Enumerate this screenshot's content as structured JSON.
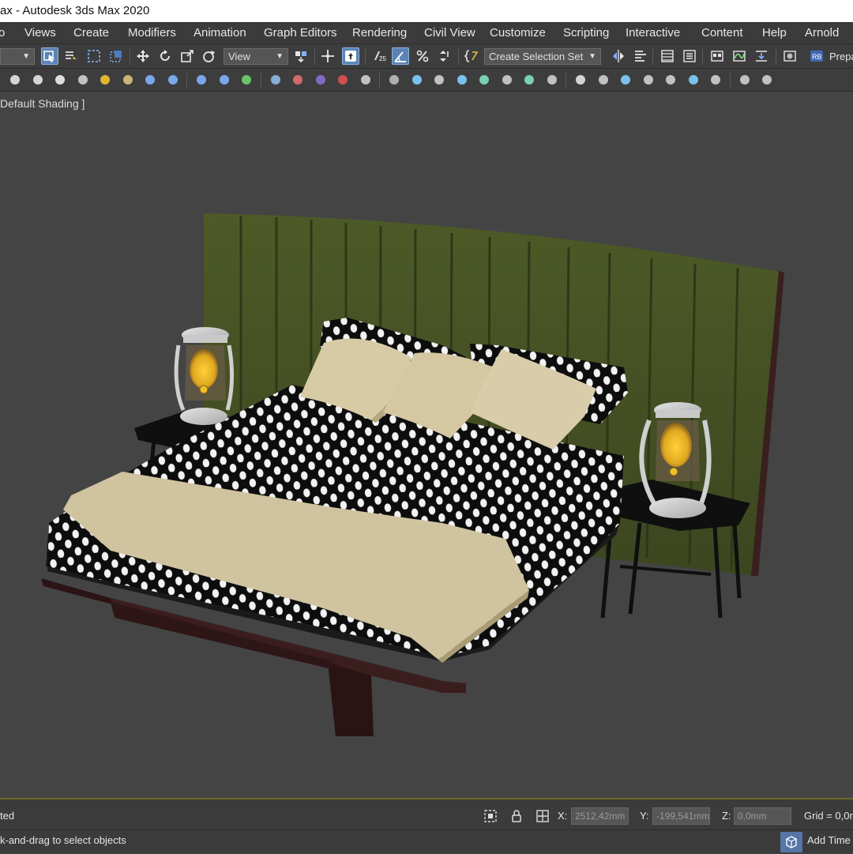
{
  "window": {
    "title": "ax - Autodesk 3ds Max 2020"
  },
  "menu": {
    "items": [
      {
        "label": "o"
      },
      {
        "label": "Views"
      },
      {
        "label": "Create"
      },
      {
        "label": "Modifiers"
      },
      {
        "label": "Animation"
      },
      {
        "label": "Graph Editors"
      },
      {
        "label": "Rendering"
      },
      {
        "label": "Civil View"
      },
      {
        "label": "Customize"
      },
      {
        "label": "Scripting"
      },
      {
        "label": "Interactive"
      },
      {
        "label": "Content"
      },
      {
        "label": "Help"
      },
      {
        "label": "Arnold"
      }
    ]
  },
  "toolbar": {
    "reference_coord": "View",
    "selection_set": "Create Selection Set",
    "snap_label": "25",
    "prepare_label": "Prepa"
  },
  "viewport": {
    "label": "Default Shading ]"
  },
  "status": {
    "selection": "ted",
    "prompt": "k-and-drag to select objects",
    "x_label": "X:",
    "x_value": "2512,42mm",
    "y_label": "Y:",
    "y_value": "-199,541mm",
    "z_label": "Z:",
    "z_value": "0,0mm",
    "grid": "Grid = 0,0r",
    "add_time": "Add Time"
  },
  "colors": {
    "headboard": "#4a5526",
    "accent_active": "#5b84b5",
    "blanket": "#cfc3a0"
  }
}
